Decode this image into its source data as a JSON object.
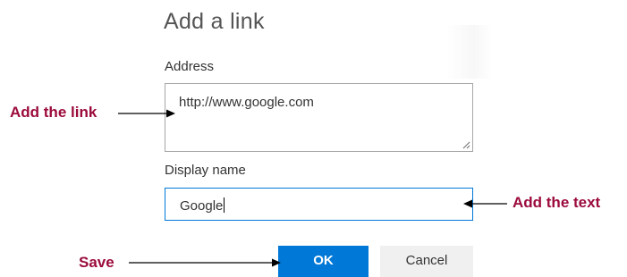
{
  "dialog": {
    "title": "Add a link",
    "address": {
      "label": "Address",
      "value": "http://www.google.com"
    },
    "display_name": {
      "label": "Display name",
      "value": "Google"
    },
    "buttons": {
      "ok_label": "OK",
      "cancel_label": "Cancel"
    }
  },
  "annotations": {
    "add_link": "Add the link",
    "add_text": "Add the text",
    "save": "Save",
    "color": "#9b0a3c"
  },
  "colors": {
    "accent": "#0078d7",
    "input_border": "#a6a6a6",
    "cancel_bg": "#f0f0f0"
  },
  "icons": {
    "resize_grip": "resize-grip-icon",
    "arrows": "arrow-right-icon / arrow-left-icon"
  }
}
